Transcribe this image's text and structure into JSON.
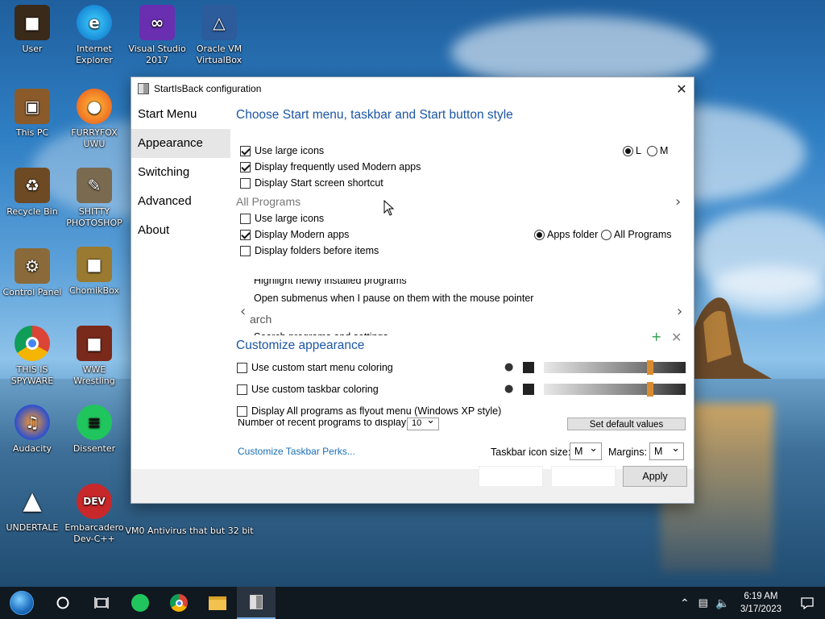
{
  "desktop": {
    "icons": [
      {
        "label": "User",
        "icon": "user-folder-icon"
      },
      {
        "label": "Internet Explorer",
        "icon": "edge-icon"
      },
      {
        "label": "Visual Studio 2017",
        "icon": "visual-studio-icon"
      },
      {
        "label": "Oracle VM VirtualBox",
        "icon": "virtualbox-icon"
      },
      {
        "label": "This PC",
        "icon": "this-pc-icon"
      },
      {
        "label": "FURRYFOX UWU",
        "icon": "firefox-icon"
      },
      {
        "label": "Recycle Bin",
        "icon": "recycle-bin-icon"
      },
      {
        "label": "SHITTY PHOTOSHOP",
        "icon": "gimp-icon"
      },
      {
        "label": "Control Panel",
        "icon": "control-panel-icon"
      },
      {
        "label": "ChomikBox",
        "icon": "chomikbox-icon"
      },
      {
        "label": "THIS IS SPYWARE",
        "icon": "chrome-icon"
      },
      {
        "label": "WWE Wrestling",
        "icon": "wwe-wrestling-icon"
      },
      {
        "label": "Audacity",
        "icon": "audacity-icon"
      },
      {
        "label": "Dissenter",
        "icon": "dissenter-icon"
      },
      {
        "label": "UNDERTALE",
        "icon": "unity-icon"
      },
      {
        "label": "Embarcadero Dev-C++",
        "icon": "devcpp-icon"
      },
      {
        "label": "VM0 Antivirus that but 32 bit",
        "icon": "antivirus-icon"
      }
    ]
  },
  "dialog": {
    "title": "StartIsBack configuration",
    "nav": [
      "Start Menu",
      "Appearance",
      "Switching",
      "Advanced",
      "About"
    ],
    "active_nav": "Appearance",
    "heading1": "Choose Start menu, taskbar and Start button style",
    "start_menu_options": [
      {
        "label": "Use large icons",
        "checked": true
      },
      {
        "label": "Display frequently used Modern apps",
        "checked": true
      },
      {
        "label": "Display Start screen shortcut",
        "checked": false
      }
    ],
    "size_radio": {
      "options": [
        "L",
        "M"
      ],
      "selected": "L"
    },
    "all_programs_title": "All Programs",
    "all_programs_options": [
      {
        "label": "Use large icons",
        "checked": false
      },
      {
        "label": "Display Modern apps",
        "checked": true
      },
      {
        "label": "Display folders before items",
        "checked": false
      }
    ],
    "modern_apps_radio": {
      "options": [
        "Apps folder",
        "All Programs"
      ],
      "selected": "Apps folder"
    },
    "faded_text_1": "Highlight newly installed programs",
    "faded_text_2": "Open submenus when I pause on them with the mouse pointer",
    "faded_text_3": "arch",
    "faded_text_4": "Search programs and settings",
    "heading2": "Customize appearance",
    "custom_options": [
      {
        "label": "Use custom start menu coloring",
        "checked": false,
        "slider": 0.75
      },
      {
        "label": "Use custom taskbar coloring",
        "checked": false,
        "slider": 0.75
      }
    ],
    "flyout_option": {
      "label": "Display All programs as flyout menu (Windows XP style)",
      "checked": false
    },
    "recent_label": "Number of recent programs to display:",
    "recent_value": "10",
    "set_default_label": "Set default values",
    "perks_link": "Customize Taskbar Perks...",
    "icon_size_label": "Taskbar icon size:",
    "icon_size_value": "M",
    "margins_label": "Margins:",
    "margins_value": "M",
    "apply_label": "Apply"
  },
  "taskbar": {
    "time": "6:19 AM",
    "date": "3/17/2023"
  },
  "colors": {
    "accent": "#1c56a3",
    "link": "#1a6fb5",
    "slider_thumb": "#d98c2f"
  }
}
